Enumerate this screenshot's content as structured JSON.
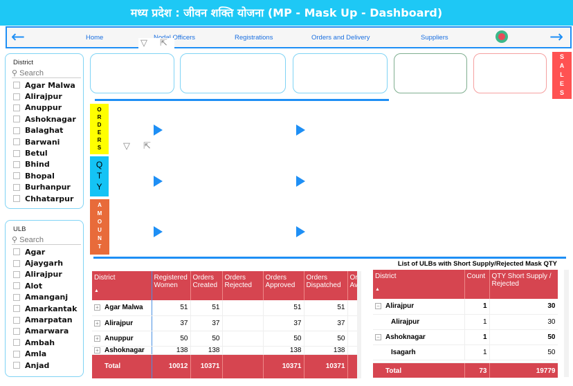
{
  "title": "मध्य प्रदेश : जीवन शक्ति योजना (MP - Mask Up - Dashboard)",
  "nav": {
    "items": [
      "Home",
      "Nodal Officers",
      "Registrations",
      "Orders and Delivery",
      "Suppliers"
    ],
    "back_icon": "arrow-left-icon",
    "forward_icon": "arrow-right-icon",
    "power_icon": "power-icon"
  },
  "district_slicer": {
    "header": "District",
    "search_placeholder": "Search",
    "items": [
      "Agar Malwa",
      "Alirajpur",
      "Anuppur",
      "Ashoknagar",
      "Balaghat",
      "Barwani",
      "Betul",
      "Bhind",
      "Bhopal",
      "Burhanpur",
      "Chhatarpur"
    ]
  },
  "ulb_slicer": {
    "header": "ULB",
    "search_placeholder": "Search",
    "items": [
      "Agar",
      "Ajaygarh",
      "Alirajpur",
      "Alot",
      "Amanganj",
      "Amarkantak",
      "Amarpatan",
      "Amarwara",
      "Ambah",
      "Amla",
      "Anjad"
    ]
  },
  "side_labels": {
    "sales": "SALES",
    "orders": "ORDERS",
    "qty": "QTY",
    "amount": "AMOUNT"
  },
  "colors": {
    "accent": "#1e8ff5",
    "header_red": "#d64550",
    "orders": "#ffff00",
    "qty": "#14c3f5",
    "amount": "#e86b3a",
    "sales": "#ff5252"
  },
  "main_table": {
    "columns": [
      "District",
      "Registered Women",
      "Orders Created",
      "Orders Rejected",
      "Orders Approved",
      "Orders Dispatched",
      "Or Av"
    ],
    "rows": [
      {
        "district": "Agar Malwa",
        "registered": "51",
        "created": "51",
        "rejected": "",
        "approved": "51",
        "dispatched": "51"
      },
      {
        "district": "Alirajpur",
        "registered": "37",
        "created": "37",
        "rejected": "",
        "approved": "37",
        "dispatched": "37"
      },
      {
        "district": "Anuppur",
        "registered": "50",
        "created": "50",
        "rejected": "",
        "approved": "50",
        "dispatched": "50"
      },
      {
        "district": "Ashoknagar",
        "registered": "138",
        "created": "138",
        "rejected": "",
        "approved": "138",
        "dispatched": "138"
      }
    ],
    "total": {
      "label": "Total",
      "registered": "10012",
      "created": "10371",
      "rejected": "",
      "approved": "10371",
      "dispatched": "10371"
    }
  },
  "short_table": {
    "title": "List of ULBs with Short Supply/Rejected Mask QTY",
    "columns": [
      "District",
      "Count",
      "QTY Short Supply / Rejected"
    ],
    "rows": [
      {
        "name": "Alirajpur",
        "count": "1",
        "qty": "30",
        "level": "district"
      },
      {
        "name": "Alirajpur",
        "count": "1",
        "qty": "30",
        "level": "ulb"
      },
      {
        "name": "Ashoknagar",
        "count": "1",
        "qty": "50",
        "level": "district"
      },
      {
        "name": "Isagarh",
        "count": "1",
        "qty": "50",
        "level": "ulb"
      }
    ],
    "total": {
      "label": "Total",
      "count": "73",
      "qty": "19779"
    }
  }
}
